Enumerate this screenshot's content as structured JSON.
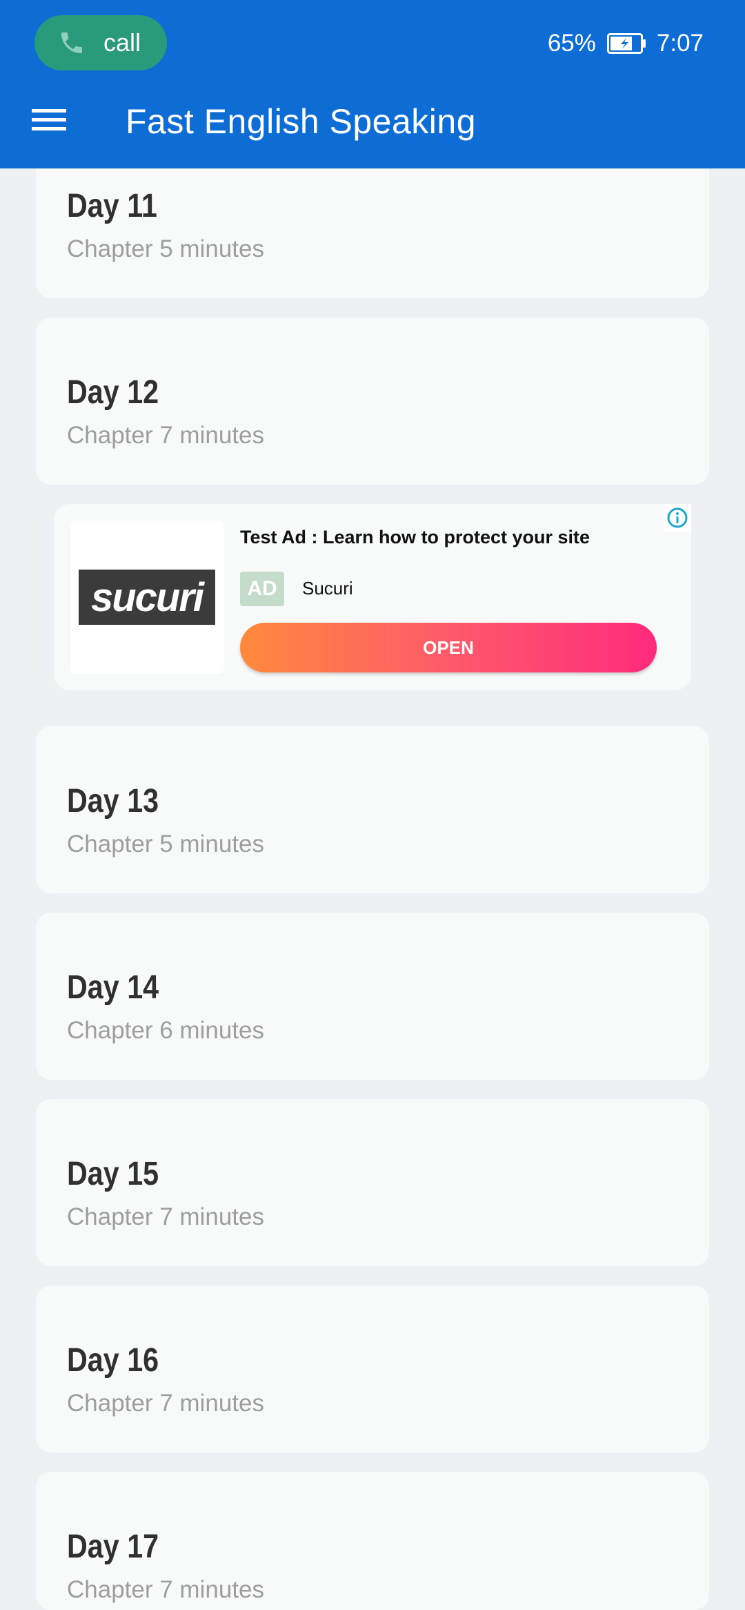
{
  "status_bar": {
    "call_label": "call",
    "battery_percent": "65%",
    "time": "7:07"
  },
  "app_bar": {
    "title": "Fast English Speaking",
    "menu_icon": "hamburger-menu-icon"
  },
  "days": [
    {
      "title": "Day 11",
      "subtitle": "Chapter 5 minutes"
    },
    {
      "title": "Day 12",
      "subtitle": "Chapter 7 minutes"
    },
    {
      "title": "Day 13",
      "subtitle": "Chapter 5 minutes"
    },
    {
      "title": "Day 14",
      "subtitle": "Chapter 6 minutes"
    },
    {
      "title": "Day 15",
      "subtitle": "Chapter 7 minutes"
    },
    {
      "title": "Day 16",
      "subtitle": "Chapter 7 minutes"
    },
    {
      "title": "Day 17",
      "subtitle": "Chapter 7 minutes"
    }
  ],
  "ad": {
    "logo_text": "sucuri",
    "title": "Test Ad : Learn how to protect your site",
    "badge": "AD",
    "advertiser": "Sucuri",
    "cta": "OPEN"
  },
  "colors": {
    "app_bar": "#0e6dd4",
    "call_pill": "#2a9a7c",
    "background": "#eff0f4",
    "card": "#f8f9f9"
  }
}
